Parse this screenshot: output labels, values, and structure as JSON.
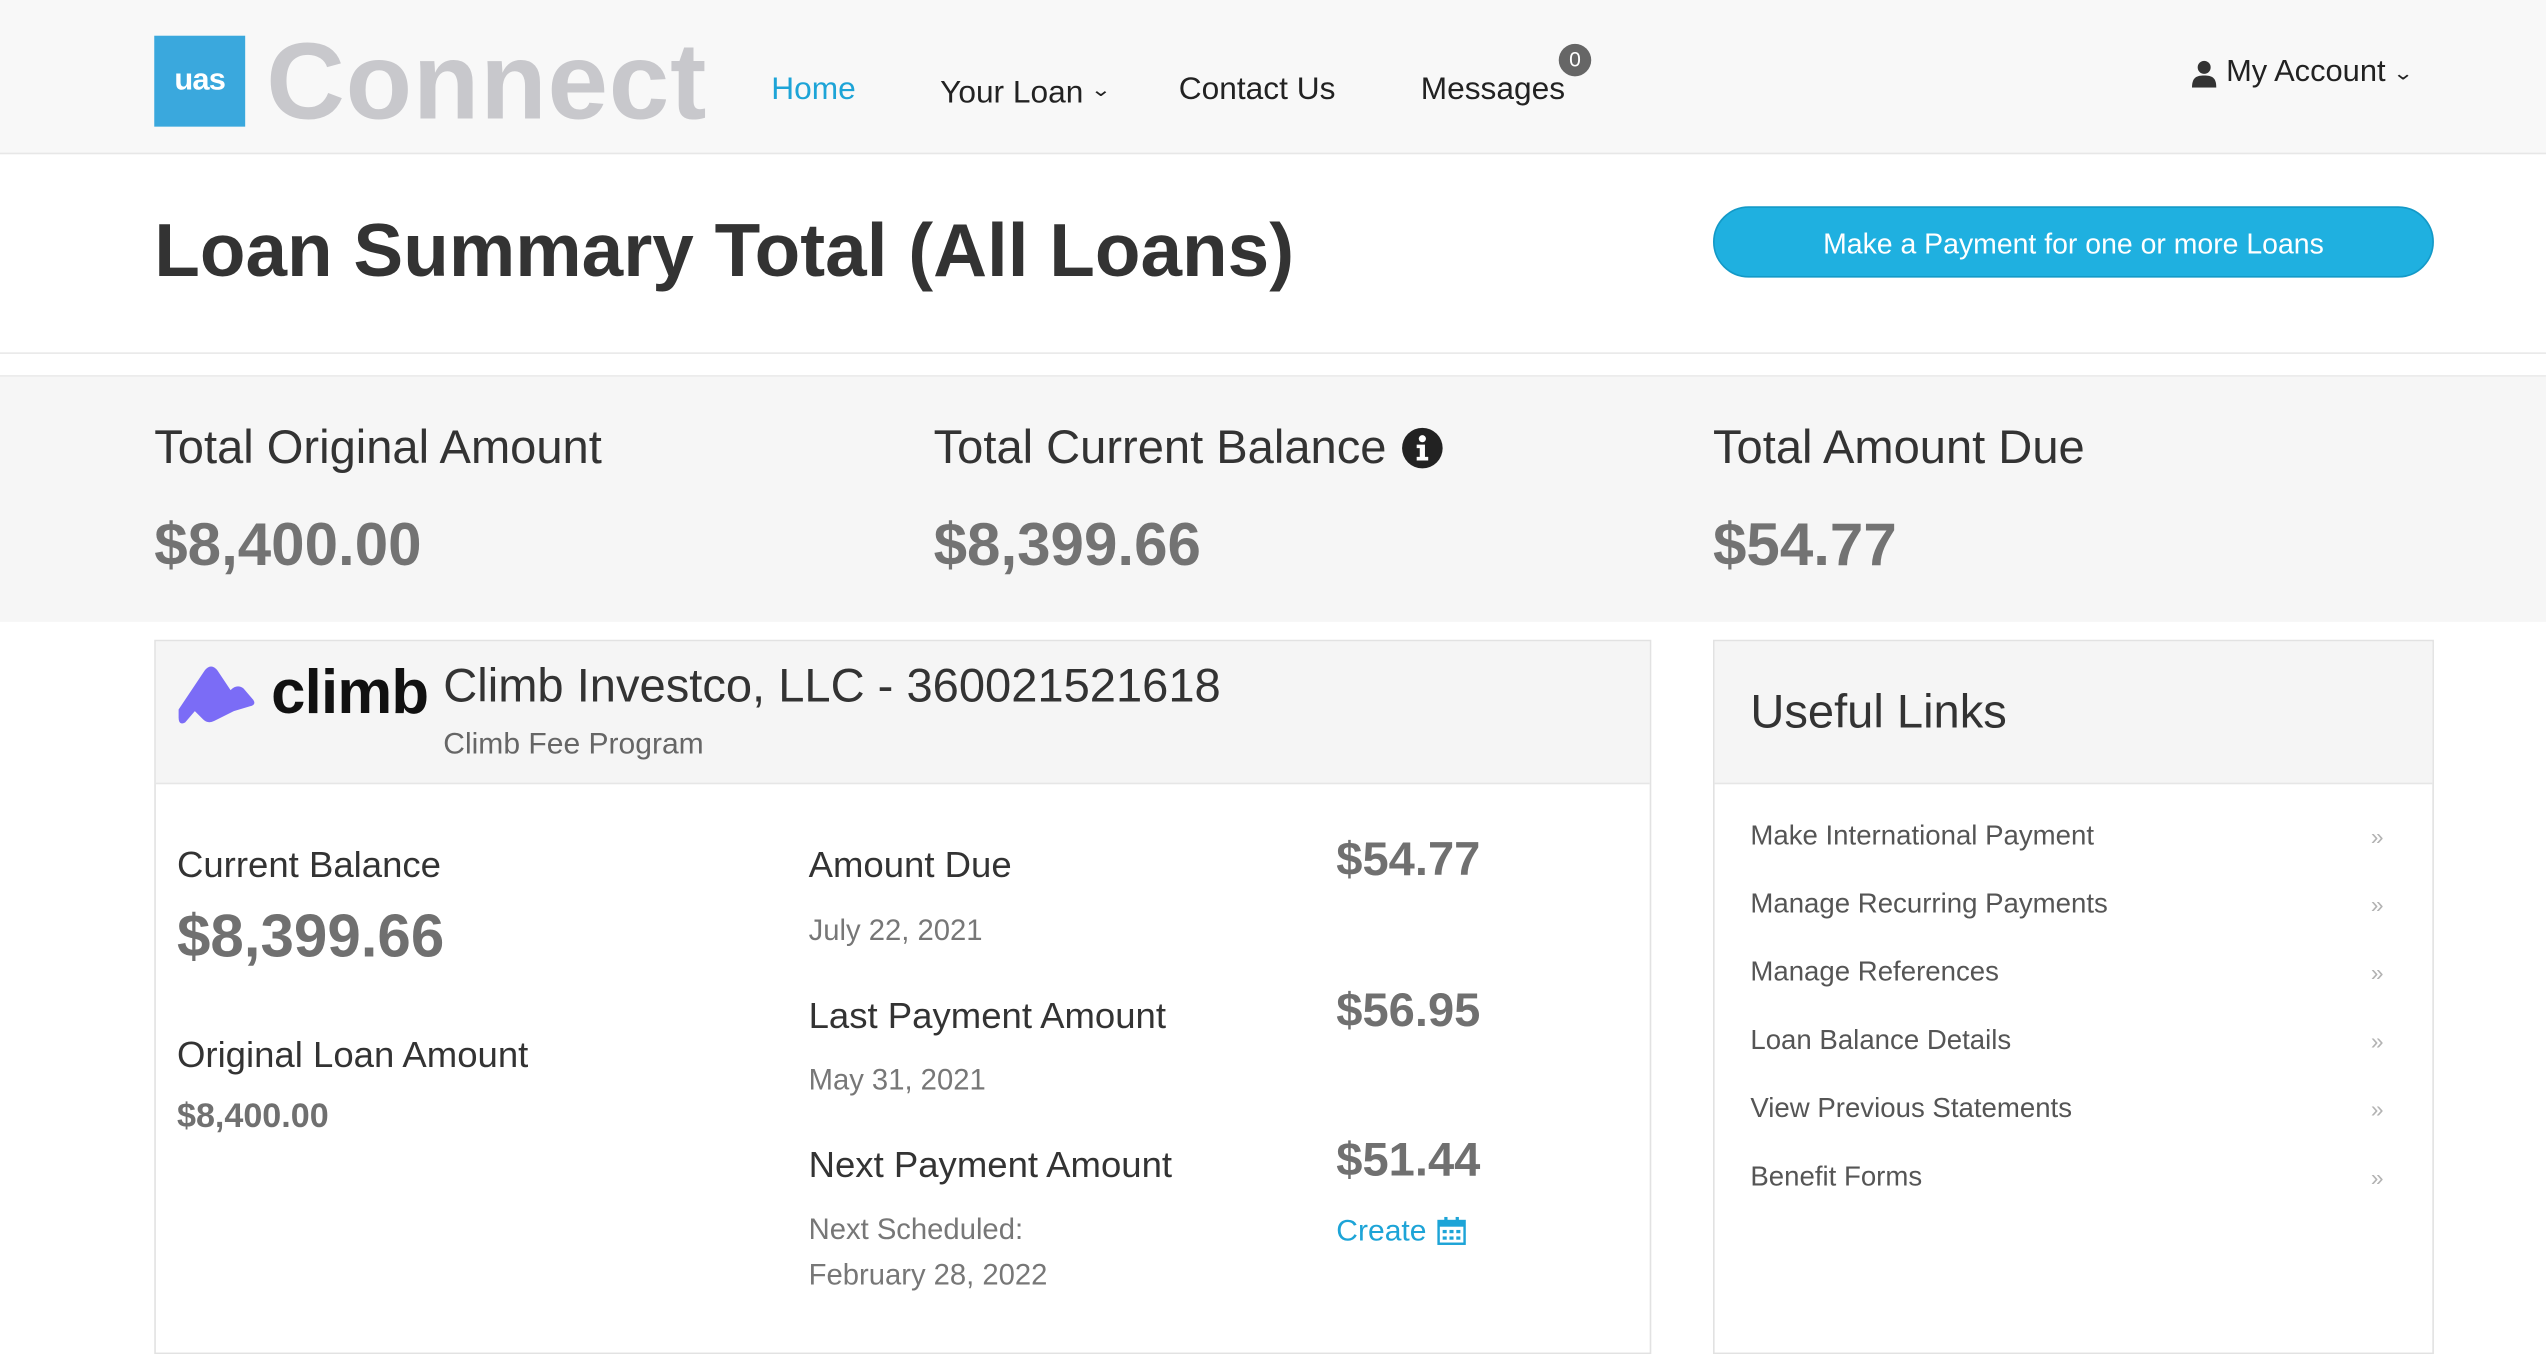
{
  "app": {
    "logo_badge": "uas",
    "logo_word": "Connect"
  },
  "nav": {
    "home": "Home",
    "your_loan": "Your Loan",
    "contact_us": "Contact Us",
    "messages": "Messages",
    "messages_count": "0",
    "my_account": "My Account",
    "active_color": "#1da4d7"
  },
  "header": {
    "title": "Loan Summary Total (All Loans)",
    "pay_button": "Make a Payment for one or more Loans",
    "pay_button_color": "#1fb0e0"
  },
  "totals": {
    "original_label": "Total Original Amount",
    "original_value": "$8,400.00",
    "current_label": "Total Current Balance",
    "current_value": "$8,399.66",
    "due_label": "Total Amount Due",
    "due_value": "$54.77"
  },
  "loan": {
    "lender_logo_text": "climb",
    "lender_logo_color": "#7b6cf6",
    "name": "Climb Investco, LLC - 360021521618",
    "program": "Climb Fee Program",
    "current_balance_label": "Current Balance",
    "current_balance": "$8,399.66",
    "original_label": "Original Loan Amount",
    "original_amount": "$8,400.00",
    "amount_due_label": "Amount Due",
    "amount_due_date": "July 22, 2021",
    "amount_due": "$54.77",
    "last_payment_label": "Last Payment Amount",
    "last_payment_date": "May 31, 2021",
    "last_payment": "$56.95",
    "next_payment_label": "Next Payment Amount",
    "next_scheduled_label": "Next Scheduled:",
    "next_scheduled_date": "February 28, 2022",
    "next_payment": "$51.44",
    "create_label": "Create"
  },
  "useful_links": {
    "title": "Useful Links",
    "items": [
      {
        "label": "Make International Payment"
      },
      {
        "label": "Manage Recurring Payments"
      },
      {
        "label": "Manage References"
      },
      {
        "label": "Loan Balance Details"
      },
      {
        "label": "View Previous Statements"
      },
      {
        "label": "Benefit Forms"
      }
    ]
  }
}
